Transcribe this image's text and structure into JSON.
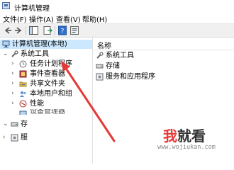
{
  "window": {
    "title": "计算机管理"
  },
  "menu": [
    "文件(F)",
    "操作(A)",
    "查看(V)",
    "帮助(H)"
  ],
  "toolbar": {
    "icons": [
      "back-icon",
      "forward-icon",
      "console-tree-icon",
      "export-list-icon",
      "help-icon",
      "properties-icon"
    ]
  },
  "tree": {
    "root": "计算机管理(本地)",
    "system_tools": "系统工具",
    "items": [
      "任务计划程序",
      "事件查看器",
      "共享文件夹",
      "本地用户和组",
      "性能",
      "设备管理器"
    ],
    "storage_partial": "存",
    "services_partial": "服"
  },
  "right_pane": {
    "header": "名称",
    "items": [
      "系统工具",
      "存储",
      "服务和应用程序"
    ]
  },
  "watermark": {
    "wo": "我",
    "rest": "就看",
    "url": "www.wojiukan.com"
  },
  "colors": {
    "selection": "#cce8ff",
    "arrow": "#e53935",
    "watermark_red": "#e53935"
  }
}
